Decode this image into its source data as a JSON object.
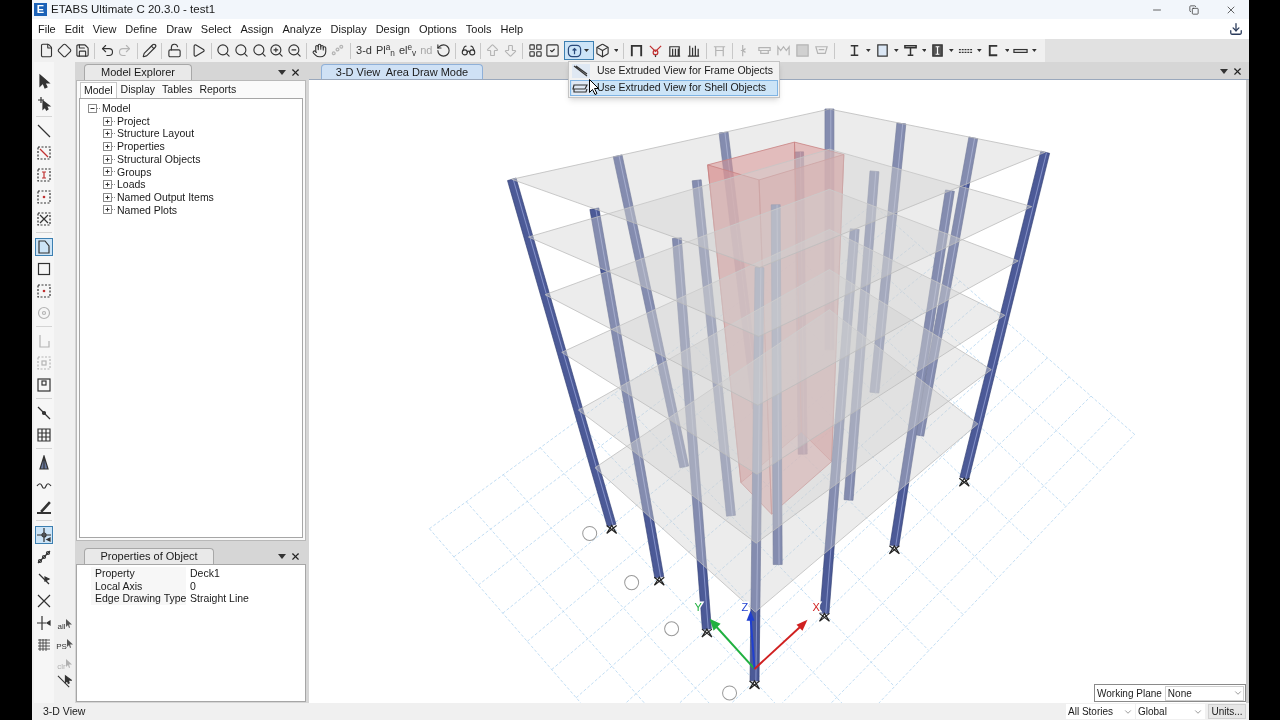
{
  "window": {
    "icon_letter": "E",
    "title": "ETABS Ultimate C 20.3.0 - test1"
  },
  "menu": [
    "File",
    "Edit",
    "View",
    "Define",
    "Draw",
    "Select",
    "Assign",
    "Analyze",
    "Display",
    "Design",
    "Options",
    "Tools",
    "Help"
  ],
  "toolbar": {
    "view_buttons": [
      {
        "label": "3-d",
        "disabled": false
      },
      {
        "label": "Pl$^{a}$$_{n}$",
        "disabled": false
      },
      {
        "label": "el$^{e}$$_{v}$",
        "disabled": false
      },
      {
        "label": "nd",
        "disabled": true
      }
    ],
    "extrude_menu": [
      {
        "label": "Use Extruded View for Frame Objects",
        "selected": false
      },
      {
        "label": "Use Extruded View for Shell Objects",
        "selected": true
      }
    ]
  },
  "left_toolbar": {
    "select_buttons": [
      {
        "label": "all",
        "disabled": false
      },
      {
        "label": "PS",
        "disabled": false
      },
      {
        "label": "clr",
        "disabled": true
      }
    ]
  },
  "model_explorer": {
    "title": "Model Explorer",
    "tabs": [
      {
        "label": "Model",
        "selected": true
      },
      {
        "label": "Display",
        "selected": false
      },
      {
        "label": "Tables",
        "selected": false
      },
      {
        "label": "Reports",
        "selected": false
      }
    ],
    "tree": {
      "label": "Model",
      "expanded": true,
      "children": [
        {
          "label": "Project",
          "expanded": false
        },
        {
          "label": "Structure Layout",
          "expanded": false
        },
        {
          "label": "Properties",
          "expanded": false
        },
        {
          "label": "Structural Objects",
          "expanded": false
        },
        {
          "label": "Groups",
          "expanded": false
        },
        {
          "label": "Loads",
          "expanded": false
        },
        {
          "label": "Named Output Items",
          "expanded": false
        },
        {
          "label": "Named Plots",
          "expanded": false
        }
      ]
    }
  },
  "properties": {
    "title": "Properties of Object",
    "rows": [
      {
        "name": "Property",
        "value": "Deck1"
      },
      {
        "name": "Local Axis",
        "value": "0"
      },
      {
        "name": "Edge Drawing Type",
        "value": "Straight Line"
      }
    ]
  },
  "view": {
    "tab": "3-D View  Area Draw Mode",
    "axes": {
      "x": "X",
      "y": "Y",
      "z": "Z"
    },
    "working_plane": {
      "label": "Working Plane",
      "value": "None"
    }
  },
  "status_bar": {
    "view": "3-D View",
    "stories": "All Stories",
    "coordinates": "Global",
    "units": "Units..."
  }
}
